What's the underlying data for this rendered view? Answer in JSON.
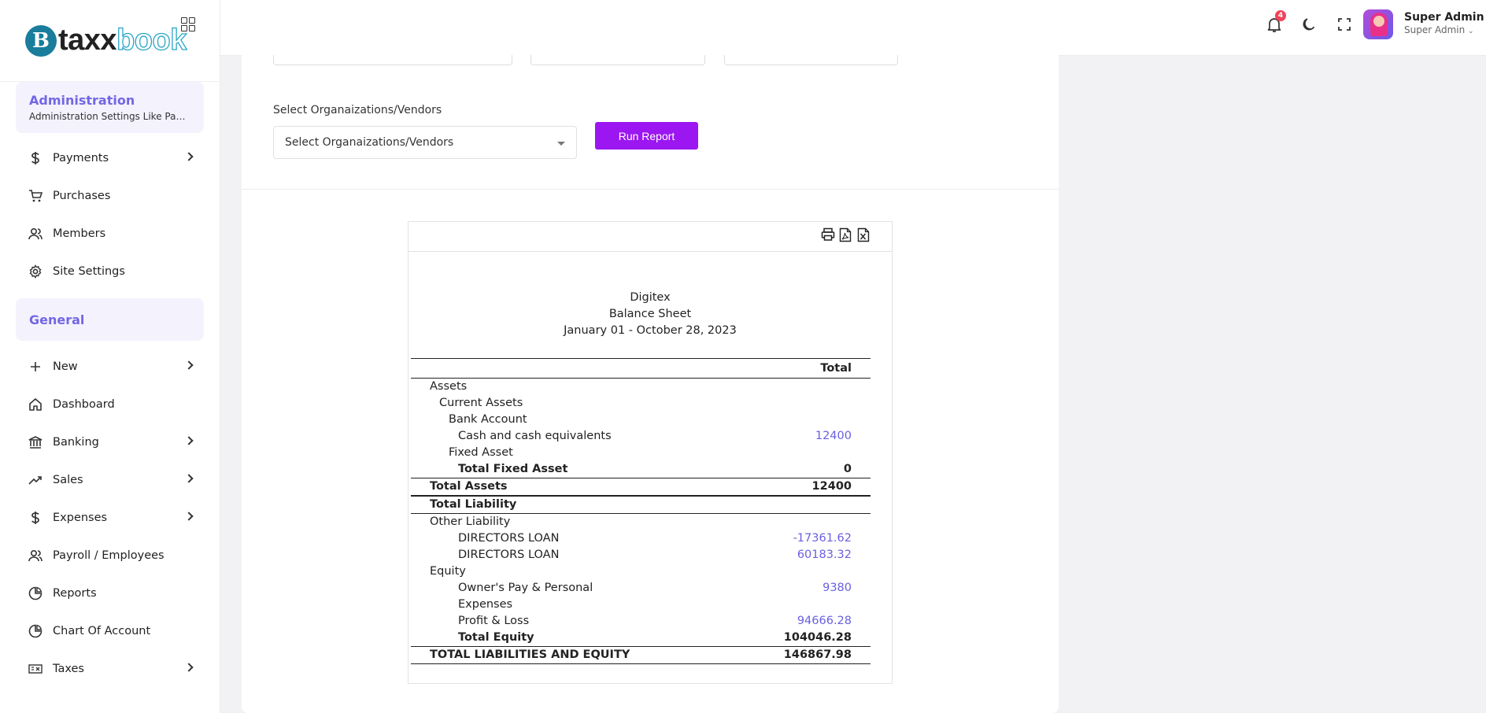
{
  "brand": {
    "part1": "taxx",
    "part2": "book",
    "mark": "B"
  },
  "sidebar": {
    "admin": {
      "title": "Administration",
      "subtitle": "Administration Settings Like Payments, Purchases, Members"
    },
    "admin_items": [
      {
        "label": "Payments",
        "icon": "dollar-icon"
      },
      {
        "label": "Purchases",
        "icon": "cart-icon"
      },
      {
        "label": "Members",
        "icon": "users-icon"
      },
      {
        "label": "Site Settings",
        "icon": "gear-icon"
      }
    ],
    "general": {
      "title": "General"
    },
    "general_items": [
      {
        "label": "New",
        "icon": "plus-icon"
      },
      {
        "label": "Dashboard",
        "icon": "home-icon"
      },
      {
        "label": "Banking",
        "icon": "bank-icon"
      },
      {
        "label": "Sales",
        "icon": "trend-icon"
      },
      {
        "label": "Expenses",
        "icon": "dollar-icon"
      },
      {
        "label": "Payroll / Employees",
        "icon": "users-icon"
      },
      {
        "label": "Reports",
        "icon": "pie-icon"
      },
      {
        "label": "Chart Of Account",
        "icon": "pie-icon"
      },
      {
        "label": "Taxes",
        "icon": "tax-icon"
      }
    ]
  },
  "topbar": {
    "notification_count": "4",
    "user_name": "Super Admin",
    "user_role": "Super Admin"
  },
  "filters": {
    "org_label": "Select Organaizations/Vendors",
    "org_placeholder": "Select Organaizations/Vendors",
    "run_button": "Run Report"
  },
  "report": {
    "company": "Digitex",
    "title": "Balance Sheet",
    "period": "January 01 - October 28, 2023",
    "total_header": "Total",
    "assets": "Assets",
    "current_assets": "Current Assets",
    "bank_account": "Bank Account",
    "cash": {
      "label": "Cash and cash equivalents",
      "value": "12400"
    },
    "fixed_asset": "Fixed Asset",
    "total_fixed_asset": {
      "label": "Total Fixed Asset",
      "value": "0"
    },
    "total_assets": {
      "label": "Total Assets",
      "value": "12400"
    },
    "total_liability": "Total Liability",
    "other_liability": "Other Liability",
    "loan1": {
      "label": "DIRECTORS LOAN",
      "value": "-17361.62"
    },
    "loan2": {
      "label": "DIRECTORS LOAN",
      "value": "60183.32"
    },
    "equity": "Equity",
    "owners_pay": {
      "label1": "Owner's Pay & Personal",
      "label2": "Expenses",
      "value": "9380"
    },
    "profit_loss": {
      "label": "Profit & Loss",
      "value": "94666.28"
    },
    "total_equity": {
      "label": "Total Equity",
      "value": "104046.28"
    },
    "total_le": {
      "label": "TOTAL LIABILITIES AND EQUITY",
      "value": "146867.98"
    }
  },
  "colors": {
    "accent": "#7267e4",
    "button": "#9b16f0",
    "link": "#6a5fe0",
    "badge": "#f04359"
  }
}
